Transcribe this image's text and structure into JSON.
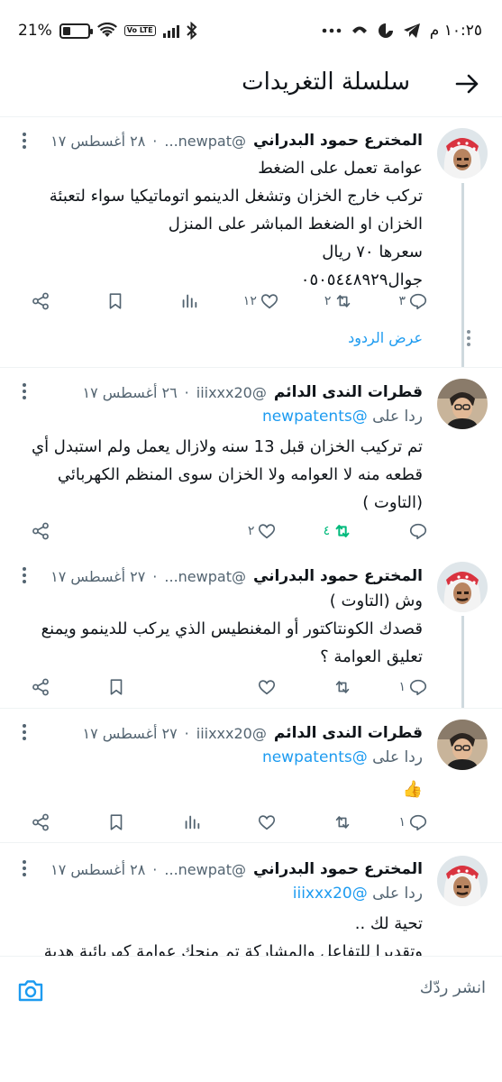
{
  "status_bar": {
    "time": "١٠:٢٥ م",
    "battery": "21%",
    "volte": "Vo LTE",
    "icons": [
      "wifi-icon",
      "signal-icon",
      "bluetooth-icon",
      "telegram-icon",
      "alarm-icon",
      "more-dots-icon"
    ]
  },
  "header": {
    "title": "سلسلة التغريدات",
    "back_icon": "arrow-back-icon"
  },
  "colors": {
    "accent": "#1d9bf0",
    "retweet_active": "#00ba7c",
    "text": "#0f1419",
    "muted": "#536471"
  },
  "tweets": [
    {
      "name": "المخترع حمود البدراني",
      "handle": "@newpat...",
      "time": "٢٨ أغسطس ١٧",
      "body": [
        "عوامة تعمل على الضغط",
        "تركب خارج الخزان وتشغل الدينمو اتوماتيكيا سواء لتعبئة",
        "الخزان او الضغط المباشر على المنزل",
        "سعرها ٧٠ ريال",
        "جوال٠٥٠٥٤٤٨٩٢٩"
      ],
      "replies": "٣",
      "retweets": "٢",
      "likes": "١٢",
      "show_replies": "عرض الردود"
    },
    {
      "name": "قطرات الندى الدائم",
      "handle": "@iiixxx20",
      "time": "٢٦ أغسطس ١٧",
      "replying_prefix": "ردا على",
      "replying_to": "@newpatents",
      "body": [
        "تم تركيب الخزان قبل 13 سنه ولازال يعمل ولم استبدل أي",
        "قطعه منه لا العوامه ولا الخزان سوى المنظم الكهربائي",
        "(التاوت )"
      ],
      "replies": "",
      "retweets": "٤",
      "likes": "٢"
    },
    {
      "name": "المخترع حمود البدراني",
      "handle": "@newpat...",
      "time": "٢٧ أغسطس ١٧",
      "body": [
        "وش (التاوت )",
        "قصدك الكونتاكتور أو المغنطيس الذي يركب للدينمو ويمنع",
        "تعليق العوامة ؟"
      ],
      "replies": "١",
      "retweets": "",
      "likes": ""
    },
    {
      "name": "قطرات الندى الدائم",
      "handle": "@iiixxx20",
      "time": "٢٧ أغسطس ١٧",
      "replying_prefix": "ردا على",
      "replying_to": "@newpatents",
      "body": [
        "👍"
      ],
      "replies": "١",
      "retweets": "",
      "likes": ""
    },
    {
      "name": "المخترع حمود البدراني",
      "handle": "@newpat...",
      "time": "٢٨ أغسطس ١٧",
      "replying_prefix": "ردا على",
      "replying_to": "@iiixxx20",
      "body": [
        "تحية لك ..",
        "وتقديرا للتفاعل والمشاركة تم منحك عوامة كهربائية هدية"
      ]
    }
  ],
  "composer": {
    "placeholder": "انشر ردّك",
    "camera_icon": "camera-icon"
  }
}
